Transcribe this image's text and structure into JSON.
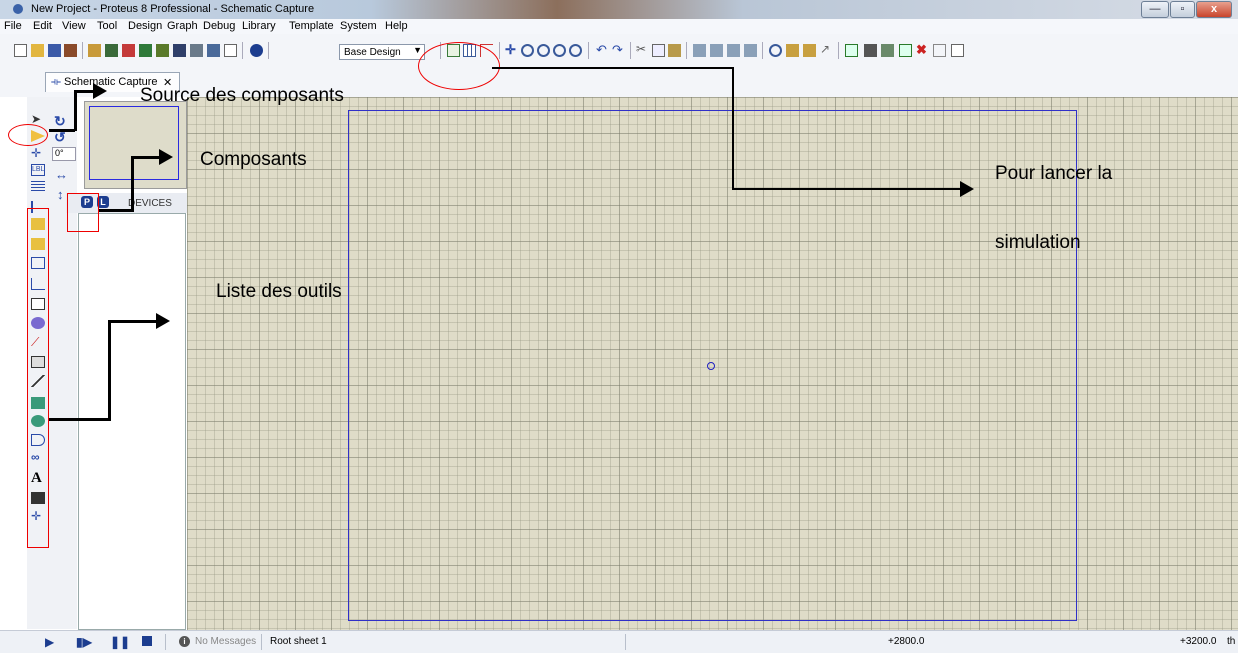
{
  "window": {
    "title": "New Project - Proteus 8 Professional - Schematic Capture",
    "minimize_icon": "minimize-icon",
    "maximize_icon": "maximize-icon",
    "close_label": "x"
  },
  "menubar": {
    "items": [
      "File",
      "Edit",
      "View",
      "Tool",
      "Design",
      "Graph",
      "Debug",
      "Library",
      "Template",
      "System",
      "Help"
    ]
  },
  "toolbar": {
    "design_select": "Base Design"
  },
  "tab": {
    "label": "Schematic Capture",
    "close": "✕"
  },
  "left_panel": {
    "rotation": "0°",
    "p_button": "P",
    "l_button": "L",
    "devices_label": "DEVICES"
  },
  "status": {
    "messages": "No Messages",
    "sheet": "Root sheet 1",
    "coord_x": "+2800.0",
    "coord_y": "+3200.0",
    "unit": "th"
  },
  "annotations": {
    "source": "Source des composants",
    "composants": "Composants",
    "liste": "Liste des outils",
    "lancer1": "Pour lancer la",
    "lancer2": "simulation"
  },
  "colors": {
    "canvas": "#dfdcc8",
    "sheet_border": "#3030c8",
    "highlight": "#e00000"
  }
}
